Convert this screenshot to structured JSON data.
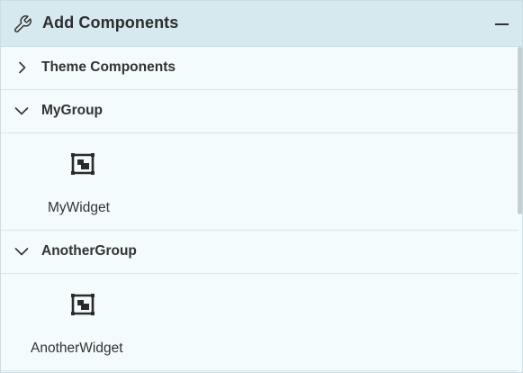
{
  "panel": {
    "title": "Add Components",
    "header_icon": "wrench-icon",
    "collapse_icon": "minus-icon"
  },
  "groups": [
    {
      "label": "Theme Components",
      "expanded": false,
      "widgets": []
    },
    {
      "label": "MyGroup",
      "expanded": true,
      "widgets": [
        {
          "label": "MyWidget",
          "icon": "widget-icon"
        }
      ]
    },
    {
      "label": "AnotherGroup",
      "expanded": true,
      "widgets": [
        {
          "label": "AnotherWidget",
          "icon": "widget-icon"
        }
      ]
    }
  ],
  "colors": {
    "header_bg": "#d6e9ef",
    "panel_bg": "#f3fbfd",
    "divider": "#d6e6eb"
  }
}
